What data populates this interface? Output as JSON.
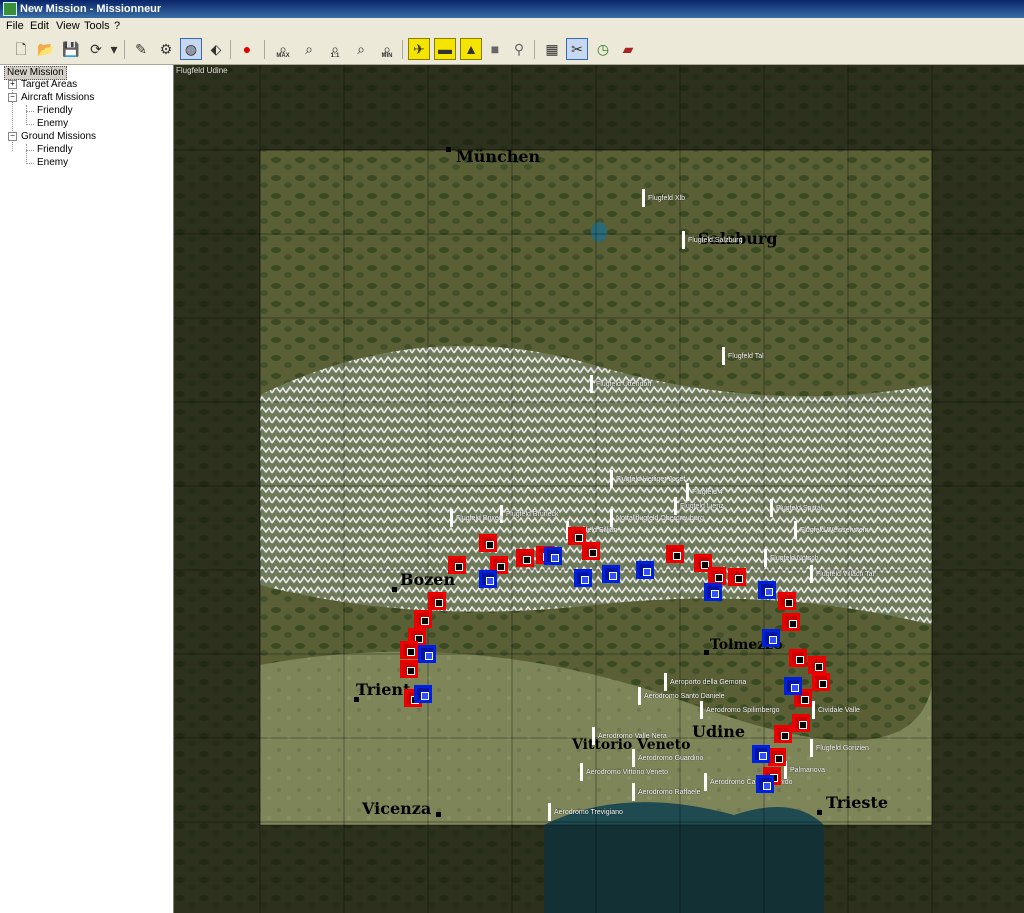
{
  "window": {
    "title": "New Mission - Missionneur"
  },
  "menu": [
    "File",
    "Edit",
    "View",
    "Tools",
    "?"
  ],
  "toolbar": {
    "zoom_max": "MAX",
    "zoom_1": "1:1",
    "zoom_min": "MIN"
  },
  "tree": {
    "root": "New Mission",
    "target_areas": "Target Areas",
    "aircraft_missions": "Aircraft Missions",
    "aircraft_friendly": "Friendly",
    "aircraft_enemy": "Enemy",
    "ground_missions": "Ground Missions",
    "ground_friendly": "Friendly",
    "ground_enemy": "Enemy"
  },
  "map": {
    "frame_label": "Flugfeld Udine",
    "cities": [
      "München",
      "Salzburg",
      "Bozen",
      "Trient",
      "Tolmezzo",
      "Udine",
      "Vittorio Veneto",
      "Vicenza",
      "Trieste"
    ],
    "airfields": [
      "Flugfeld Xlb",
      "Flugfeld Salzburg",
      "Flugfeld Tal",
      "Flugfeld Uttendorf",
      "Flugfeld Heiliger Josef",
      "Flugfeld 4",
      "Flugfeld Bruneck",
      "Flugfeld Brixen",
      "Flugfeld Sillian",
      "Notfallflugfeld Oberdrauburg",
      "Flugfeld Lienz",
      "Flugfeld Spittal",
      "Flugfeld Weissenstein",
      "Flugfeld Nötsch",
      "Flugfeld Villach Tal",
      "Aeroporto della Gemona",
      "Aerodromo Santo Daniele",
      "Aerodromo Spilimbergo",
      "Cividale Valle",
      "Aerodromo Valle Nera",
      "Aerodromo Guardino",
      "Aerodromo Vittorio Veneto",
      "Aerodromo Raffaele",
      "Aerodromo Campoformido",
      "Flugfeld Gorizien",
      "Palmanova",
      "Aerodromo Trevigiano"
    ],
    "colors": {
      "friendly": "#0020e0",
      "enemy": "#e00000"
    }
  }
}
